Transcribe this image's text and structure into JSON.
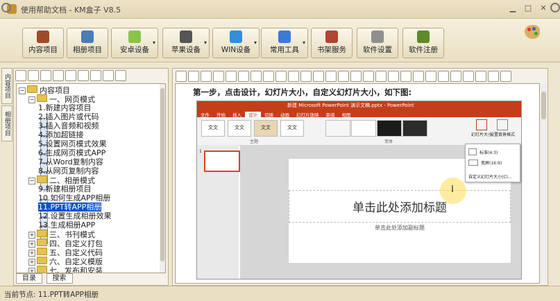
{
  "window": {
    "title": "使用帮助文档 - KM盒子 V8.5",
    "min": "▁",
    "max": "□",
    "close": "✕"
  },
  "toolbar": [
    {
      "label": "内容项目",
      "icon": "book-icon",
      "color": "#a04b28"
    },
    {
      "label": "相册项目",
      "icon": "photo-icon",
      "color": "#4a7cb5"
    },
    {
      "label": "安卓设备",
      "icon": "android-icon",
      "color": "#8bc34a",
      "drop": true
    },
    {
      "label": "苹果设备",
      "icon": "apple-icon",
      "color": "#555555",
      "drop": true
    },
    {
      "label": "WIN设备",
      "icon": "windows-icon",
      "color": "#2f8fd8",
      "drop": true
    },
    {
      "label": "常用工具",
      "icon": "tools-icon",
      "color": "#3b7bd6",
      "drop": true
    },
    {
      "label": "书架服务",
      "icon": "bookshelf-icon",
      "color": "#b04532"
    },
    {
      "label": "软件设置",
      "icon": "gear-icon",
      "color": "#8f8f8f"
    },
    {
      "label": "软件注册",
      "icon": "register-icon",
      "color": "#5d8a2a"
    }
  ],
  "left_tabs": [
    "内容项目",
    "相册项目"
  ],
  "tree": [
    {
      "label": "内容项目",
      "level": 0,
      "type": "folder",
      "exp": "-"
    },
    {
      "label": "一、网页模式",
      "level": 1,
      "type": "folder",
      "exp": "-"
    },
    {
      "label": "1.新建内容项目",
      "level": 2,
      "type": "doc"
    },
    {
      "label": "2.插入图片或代码",
      "level": 2,
      "type": "doc"
    },
    {
      "label": "3.插入音频和视频",
      "level": 2,
      "type": "doc"
    },
    {
      "label": "4.添加超链接",
      "level": 2,
      "type": "doc"
    },
    {
      "label": "5.设置网页模式效果",
      "level": 2,
      "type": "doc"
    },
    {
      "label": "6.生成网页模式APP",
      "level": 2,
      "type": "doc"
    },
    {
      "label": "7.从Word复制内容",
      "level": 2,
      "type": "doc"
    },
    {
      "label": "8.从网页复制内容",
      "level": 2,
      "type": "doc"
    },
    {
      "label": "二、相册模式",
      "level": 1,
      "type": "folder",
      "exp": "-"
    },
    {
      "label": "9.新建相册项目",
      "level": 2,
      "type": "doc"
    },
    {
      "label": "10.如何生成APP相册",
      "level": 2,
      "type": "doc"
    },
    {
      "label": "11.PPT转APP相册",
      "level": 2,
      "type": "doc",
      "selected": true
    },
    {
      "label": "12.设置生成相册效果",
      "level": 2,
      "type": "doc"
    },
    {
      "label": "13.生成相册APP",
      "level": 2,
      "type": "doc"
    },
    {
      "label": "三、书刊模式",
      "level": 1,
      "type": "folder",
      "exp": "+"
    },
    {
      "label": "四、自定义打包",
      "level": 1,
      "type": "folder",
      "exp": "+"
    },
    {
      "label": "五、自定义代码",
      "level": 1,
      "type": "folder",
      "exp": "+"
    },
    {
      "label": "六、自定义模版",
      "level": 1,
      "type": "folder",
      "exp": "+"
    },
    {
      "label": "七、发布和安装",
      "level": 1,
      "type": "folder",
      "exp": "+"
    }
  ],
  "bottom_tabs": [
    "目录",
    "搜索"
  ],
  "content": {
    "step_text": "第一步，点击设计，幻灯片大小，自定义幻灯片大小，如下图:",
    "ppt": {
      "title": "新建 Microsoft PowerPoint 演示文稿.pptx - PowerPoint",
      "tabs": [
        "文件",
        "开始",
        "插入",
        "设计",
        "切换",
        "动画",
        "幻灯片放映",
        "审阅",
        "视图"
      ],
      "active_tab": "设计",
      "themes": [
        "文文",
        "文文",
        "文文",
        "文文"
      ],
      "group_theme": "主题",
      "group_variant": "变体",
      "slide_size": "幻灯片大小",
      "format_bg": "设置背景格式",
      "menu_items": [
        "标准(4:3)",
        "宽屏(16:9)",
        "自定义幻灯片大小(C)..."
      ],
      "slide_num": "1",
      "slide_title": "单击此处添加标题",
      "slide_subtitle": "单击此处添加副标题"
    }
  },
  "status": "当前节点: 11.PPT转APP相册"
}
